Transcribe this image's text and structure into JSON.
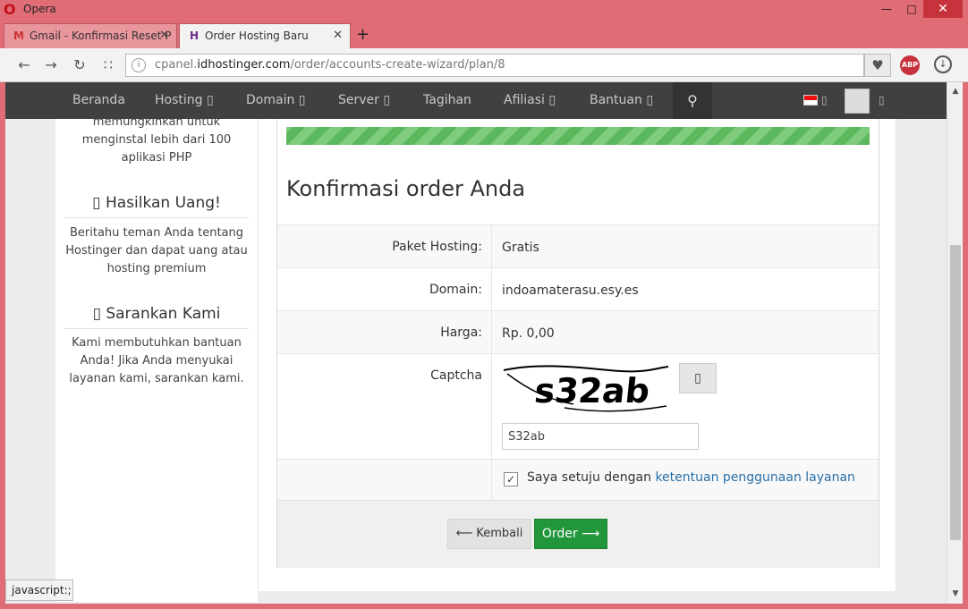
{
  "window": {
    "title": "Opera"
  },
  "tabs": [
    {
      "label": "Gmail - Konfirmasi Reset P",
      "favicon": "M"
    },
    {
      "label": "Order Hosting Baru",
      "favicon": "H"
    }
  ],
  "toolbar": {
    "url_prefix": "cpanel.",
    "url_domain": "idhostinger.com",
    "url_path": "/order/accounts-create-wizard/plan/8",
    "abp_label": "ABP"
  },
  "nav": {
    "items": [
      "Beranda",
      "Hosting",
      "Domain",
      "Server",
      "Tagihan",
      "Afiliasi",
      "Bantuan"
    ],
    "caret": "▯"
  },
  "sidebar": {
    "intro_text": "memungkinkan untuk menginstal lebih dari 100 aplikasi PHP",
    "earn_heading": "Hasilkan Uang!",
    "earn_text": "Beritahu teman Anda tentang Hostinger dan dapat uang atau hosting premium",
    "suggest_heading": "Sarankan Kami",
    "suggest_text": "Kami membutuhkan bantuan Anda! Jika Anda menyukai layanan kami, sarankan kami.",
    "heading_icon": "▯"
  },
  "main": {
    "title": "Konfirmasi order Anda",
    "progress_percent": 100,
    "rows": [
      {
        "label": "Paket Hosting:",
        "value": "Gratis"
      },
      {
        "label": "Domain:",
        "value": "indoamaterasu.esy.es"
      },
      {
        "label": "Harga:",
        "value": "Rp. 0,00"
      }
    ],
    "captcha_label": "Captcha",
    "captcha_image_text": "s32ab",
    "captcha_input_value": "S32ab",
    "refresh_icon": "▯",
    "terms_text": "Saya setuju dengan ",
    "terms_link": "ketentuan penggunaan layanan",
    "terms_checked": true,
    "back_label": "Kembali",
    "order_label": "Order"
  },
  "statusbar": {
    "text": "javascript:;"
  }
}
